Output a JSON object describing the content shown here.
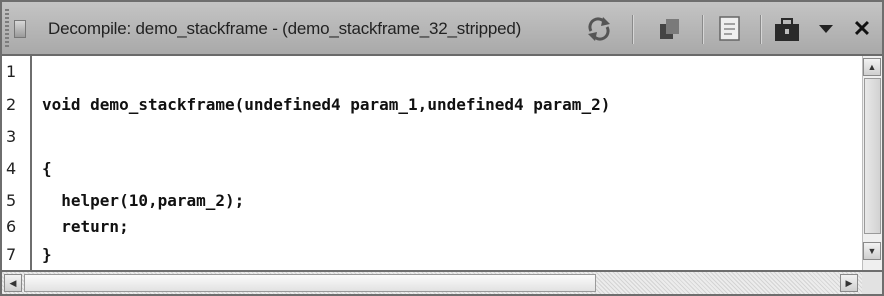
{
  "window": {
    "title": "Decompile: demo_stackframe -  (demo_stackframe_32_stripped)"
  },
  "toolbar": {
    "icons": [
      "refresh-icon",
      "copy-icon",
      "snapshot-icon",
      "export-icon",
      "dropdown-menu-icon",
      "close-icon"
    ],
    "close_glyph": "✕"
  },
  "code": {
    "lines": [
      {
        "number": "1",
        "text": ""
      },
      {
        "number": "2",
        "text": "void demo_stackframe(undefined4 param_1,undefined4 param_2)"
      },
      {
        "number": "3",
        "text": ""
      },
      {
        "number": "4",
        "text": "{"
      },
      {
        "number": "5",
        "text": "  helper(10,param_2);"
      },
      {
        "number": "6",
        "text": "  return;"
      },
      {
        "number": "7",
        "text": "}"
      }
    ]
  },
  "scrollbars": {
    "up_arrow": "▲",
    "down_arrow": "▼",
    "left_arrow": "◀",
    "right_arrow": "▶"
  }
}
